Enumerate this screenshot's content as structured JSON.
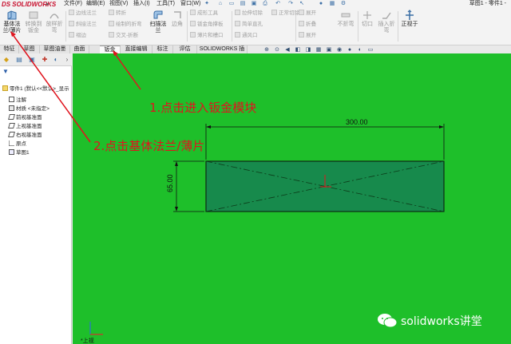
{
  "app": {
    "logo_ds": "DS",
    "logo_name": "SOLIDWORKS",
    "doc_title": "草图1 - 零件1 -"
  },
  "menu": {
    "items": [
      "文件(F)",
      "编辑(E)",
      "视图(V)",
      "插入(I)",
      "工具(T)",
      "窗口(W)"
    ]
  },
  "commands": {
    "base_flange": "基体法\n兰/薄片",
    "convert_to_sheetmetal": "转换到\n钣金",
    "lofted_bend": "放样折\n弯",
    "sweep_flange": "扫描法\n兰",
    "edge_flange": "边线法兰",
    "miter_flange": "斜接法兰",
    "hem": "褶边",
    "jog": "转折",
    "sketched_bend": "绘制的折弯",
    "cross_break": "交叉-折断",
    "corners": "边角",
    "forming_tool": "成形工具",
    "sheetmetal_gusset": "钣金角撑板",
    "tab_and_slot": "薄片和槽口",
    "extruded_cut": "拉伸切除",
    "simple_hole": "简单直孔",
    "vent": "通风口",
    "normal_cut": "正常切除",
    "unfold": "展开",
    "fold": "折叠",
    "flatten": "展开",
    "no_bends": "不折弯",
    "rip": "切口",
    "insert_bends": "插入折\n弯",
    "rebuild": "正视于"
  },
  "tabs": [
    {
      "label": "特征",
      "active": false
    },
    {
      "label": "草图",
      "active": false
    },
    {
      "label": "草图油墨",
      "active": false
    },
    {
      "label": "曲面",
      "active": false
    },
    {
      "label": "钣金",
      "active": true
    },
    {
      "label": "直接编辑",
      "active": false
    },
    {
      "label": "标注",
      "active": false
    },
    {
      "label": "评估",
      "active": false
    },
    {
      "label": "SOLIDWORKS 插件",
      "active": false
    }
  ],
  "tree": {
    "root": "零件1 (默认<<默认>_显示",
    "items": [
      {
        "label": "注解",
        "icon": "annotation-icon"
      },
      {
        "label": "材质 <未指定>",
        "icon": "material-icon"
      },
      {
        "label": "前视基准面",
        "icon": "plane-icon"
      },
      {
        "label": "上视基准面",
        "icon": "plane-icon"
      },
      {
        "label": "右视基准面",
        "icon": "plane-icon"
      },
      {
        "label": "原点",
        "icon": "origin-icon"
      },
      {
        "label": "草图1",
        "icon": "sketch-icon"
      }
    ]
  },
  "sketch": {
    "width_dim": "300.00",
    "height_dim": "65.00",
    "rect_fill": "#178a4c",
    "background": "#1ebf2a"
  },
  "annotations": {
    "step1": "1.点击进入钣金模块",
    "step2": "2.点击基体法兰/薄片",
    "color": "#e0141e"
  },
  "triad_label": "*上视",
  "watermark": "solidworks讲堂"
}
